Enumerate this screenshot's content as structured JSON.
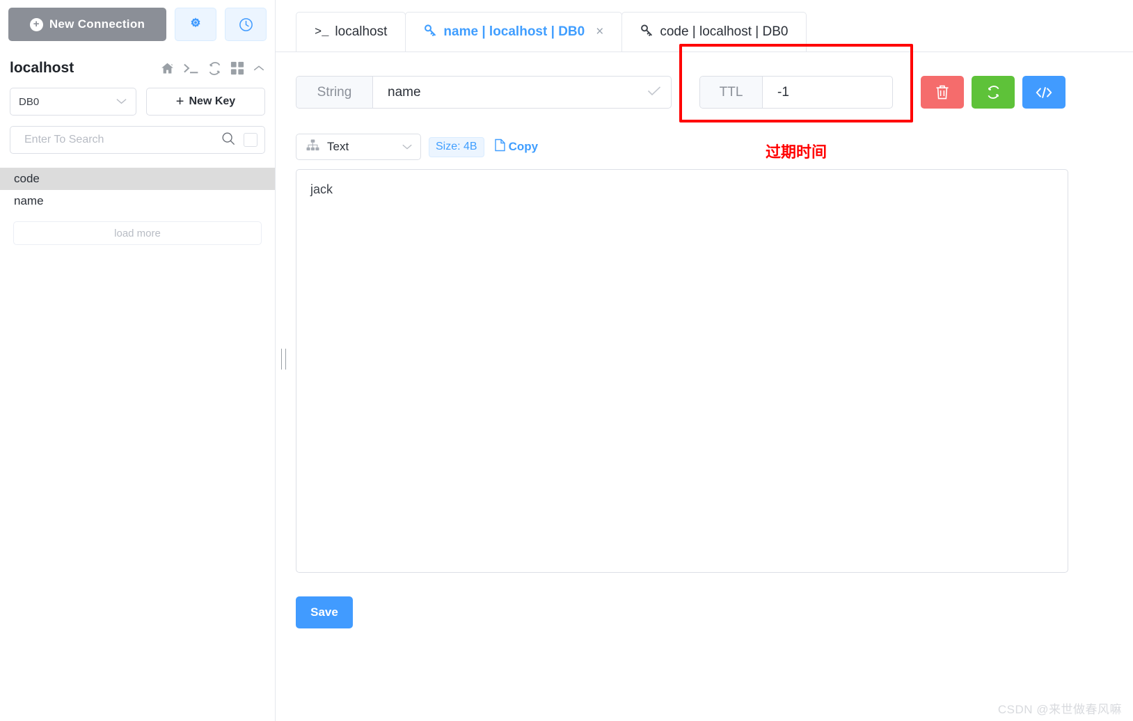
{
  "sidebar": {
    "new_connection_label": "New Connection",
    "settings_icon": "gear-icon",
    "history_icon": "clock-icon",
    "host_title": "localhost",
    "tool_icons": [
      "home-icon",
      "terminal-icon",
      "refresh-icon",
      "grid-icon",
      "chevron-up-icon"
    ],
    "db_selected": "DB0",
    "new_key_label": "New Key",
    "search_placeholder": "Enter To Search",
    "search_value": "",
    "keys": [
      {
        "name": "code",
        "selected": true
      },
      {
        "name": "name",
        "selected": false
      }
    ],
    "load_more_label": "load more"
  },
  "tabs": [
    {
      "label": "localhost",
      "icon": "terminal-icon",
      "active": false,
      "closable": false
    },
    {
      "label": "name | localhost | DB0",
      "icon": "key-icon",
      "active": true,
      "closable": true,
      "close_glyph": "×"
    },
    {
      "label": "code | localhost | DB0",
      "icon": "key-icon",
      "active": false,
      "closable": false
    }
  ],
  "editor": {
    "key_type_label": "String",
    "key_name_value": "name",
    "key_confirm_icon": "check-icon",
    "ttl_label": "TTL",
    "ttl_value": "-1",
    "ttl_clear_icon": "close-icon",
    "ttl_confirm_icon": "check-icon",
    "annotation_text": "过期时间",
    "annotation_color": "#ff0000",
    "actions": [
      {
        "name": "delete-key-button",
        "icon": "trash-icon",
        "color": "#f56c6c"
      },
      {
        "name": "refresh-key-button",
        "icon": "refresh-icon",
        "color": "#5ec239"
      },
      {
        "name": "view-code-button",
        "icon": "code-icon",
        "color": "#419bff"
      }
    ],
    "format_selected": "Text",
    "format_icon": "sitemap-icon",
    "size_badge": "Size: 4B",
    "copy_label": "Copy",
    "copy_icon": "document-icon",
    "value_content": "jack",
    "save_label": "Save"
  },
  "watermark": "CSDN @来世做春风嘛",
  "colors": {
    "accent": "#409eff",
    "primary_button": "#419bff",
    "danger": "#f56c6c",
    "success": "#5ec239",
    "annotation": "#ff0000",
    "muted": "#8b9099"
  }
}
